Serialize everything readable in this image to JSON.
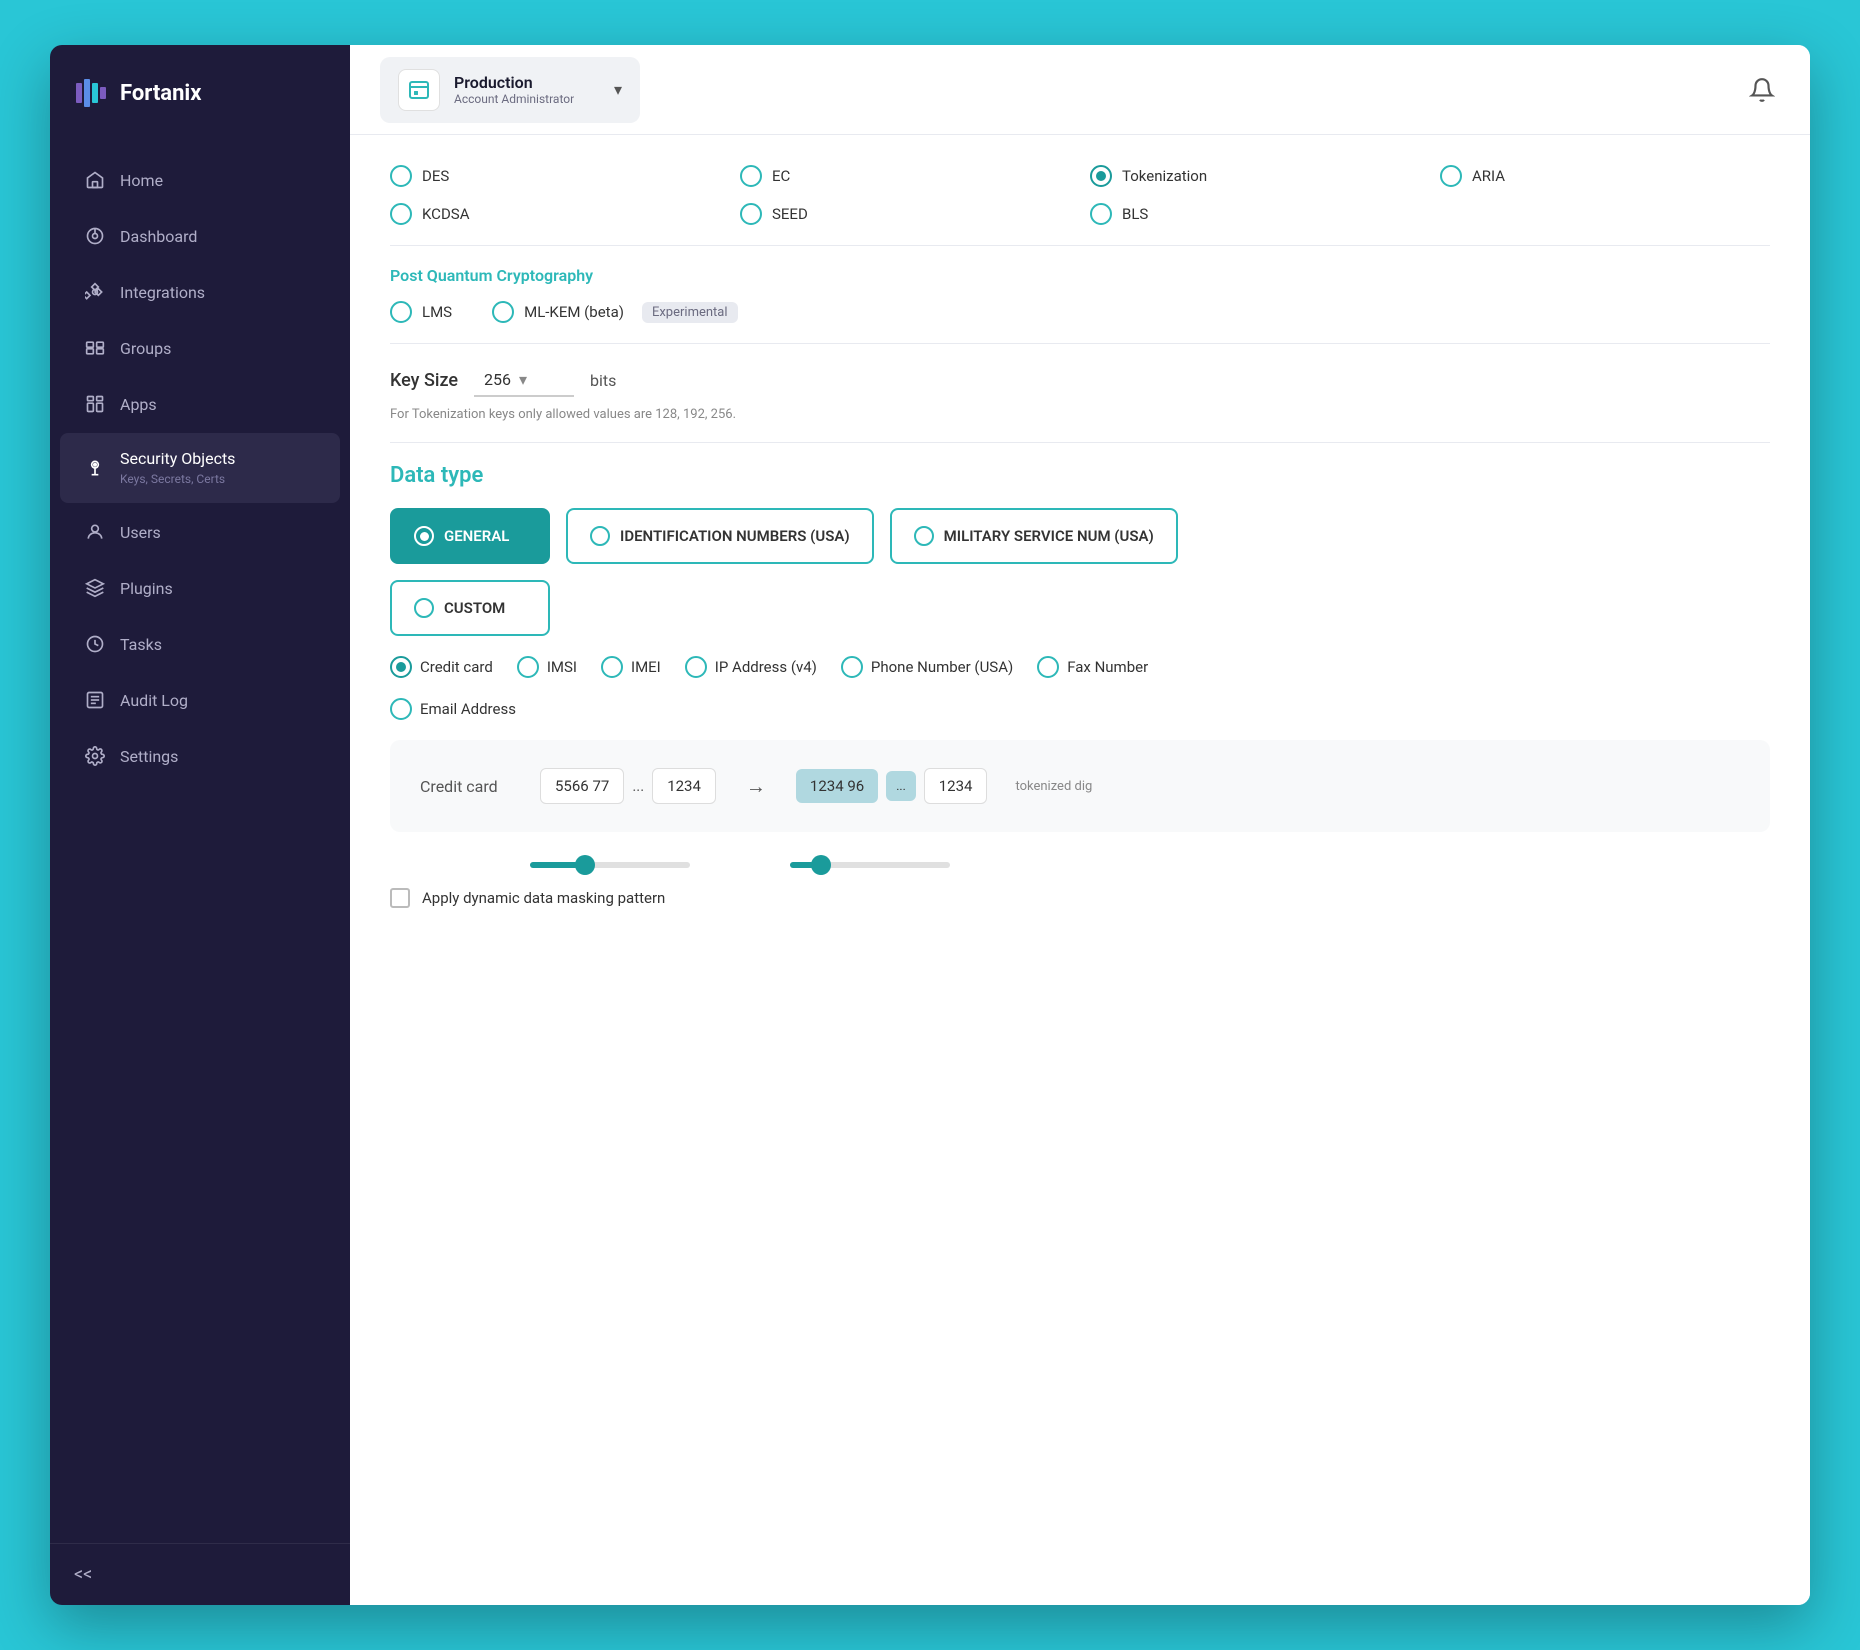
{
  "sidebar": {
    "logo": "Fortanix",
    "nav_items": [
      {
        "id": "home",
        "label": "Home",
        "active": false
      },
      {
        "id": "dashboard",
        "label": "Dashboard",
        "active": false
      },
      {
        "id": "integrations",
        "label": "Integrations",
        "active": false
      },
      {
        "id": "groups",
        "label": "Groups",
        "active": false
      },
      {
        "id": "apps",
        "label": "Apps",
        "active": false
      },
      {
        "id": "security-objects",
        "label": "Security Objects",
        "sub": "Keys, Secrets, Certs",
        "active": true
      },
      {
        "id": "users",
        "label": "Users",
        "active": false
      },
      {
        "id": "plugins",
        "label": "Plugins",
        "active": false
      },
      {
        "id": "tasks",
        "label": "Tasks",
        "active": false
      },
      {
        "id": "audit-log",
        "label": "Audit Log",
        "active": false
      },
      {
        "id": "settings",
        "label": "Settings",
        "active": false
      }
    ],
    "collapse_label": "<<"
  },
  "topbar": {
    "account_name": "Production",
    "account_role": "Account Administrator",
    "notification_icon": "🔔"
  },
  "content": {
    "algorithms": {
      "row1": [
        {
          "id": "des",
          "label": "DES",
          "selected": false
        },
        {
          "id": "ec",
          "label": "EC",
          "selected": false
        },
        {
          "id": "tokenization",
          "label": "Tokenization",
          "selected": true
        },
        {
          "id": "aria",
          "label": "ARIA",
          "selected": false
        }
      ],
      "row2": [
        {
          "id": "kcdsa",
          "label": "KCDSA",
          "selected": false
        },
        {
          "id": "seed",
          "label": "SEED",
          "selected": false
        },
        {
          "id": "bls",
          "label": "BLS",
          "selected": false
        }
      ]
    },
    "post_quantum": {
      "title": "Post Quantum Cryptography",
      "options": [
        {
          "id": "lms",
          "label": "LMS",
          "selected": false
        },
        {
          "id": "ml-kem",
          "label": "ML-KEM (beta)",
          "badge": "Experimental",
          "selected": false
        }
      ]
    },
    "key_size": {
      "label": "Key Size",
      "value": "256",
      "unit": "bits",
      "hint": "For Tokenization keys only allowed values are 128, 192, 256."
    },
    "data_type": {
      "title": "Data type",
      "options": [
        {
          "id": "general",
          "label": "GENERAL",
          "selected": true
        },
        {
          "id": "identification-numbers",
          "label": "IDENTIFICATION NUMBERS (USA)",
          "selected": false
        },
        {
          "id": "military-service",
          "label": "MILITARY SERVICE NUM (USA)",
          "selected": false
        },
        {
          "id": "custom",
          "label": "CUSTOM",
          "selected": false
        }
      ]
    },
    "sub_options": [
      {
        "id": "credit-card",
        "label": "Credit card",
        "selected": true
      },
      {
        "id": "imsi",
        "label": "IMSI",
        "selected": false
      },
      {
        "id": "imei",
        "label": "IMEI",
        "selected": false
      },
      {
        "id": "ip-address",
        "label": "IP Address (v4)",
        "selected": false
      },
      {
        "id": "phone-number",
        "label": "Phone Number (USA)",
        "selected": false
      },
      {
        "id": "fax-number",
        "label": "Fax Number",
        "selected": false
      }
    ],
    "email_option": {
      "id": "email-address",
      "label": "Email Address",
      "selected": false
    },
    "cc_preview": {
      "label": "Credit card",
      "segments": [
        "5566 77",
        "...",
        "1234"
      ],
      "arrow": "→",
      "tokenized": [
        "1234 96",
        "...",
        "1234"
      ],
      "tok_label": "tokenized dig"
    },
    "masking": {
      "label": "Apply dynamic data masking pattern",
      "checked": false
    }
  }
}
